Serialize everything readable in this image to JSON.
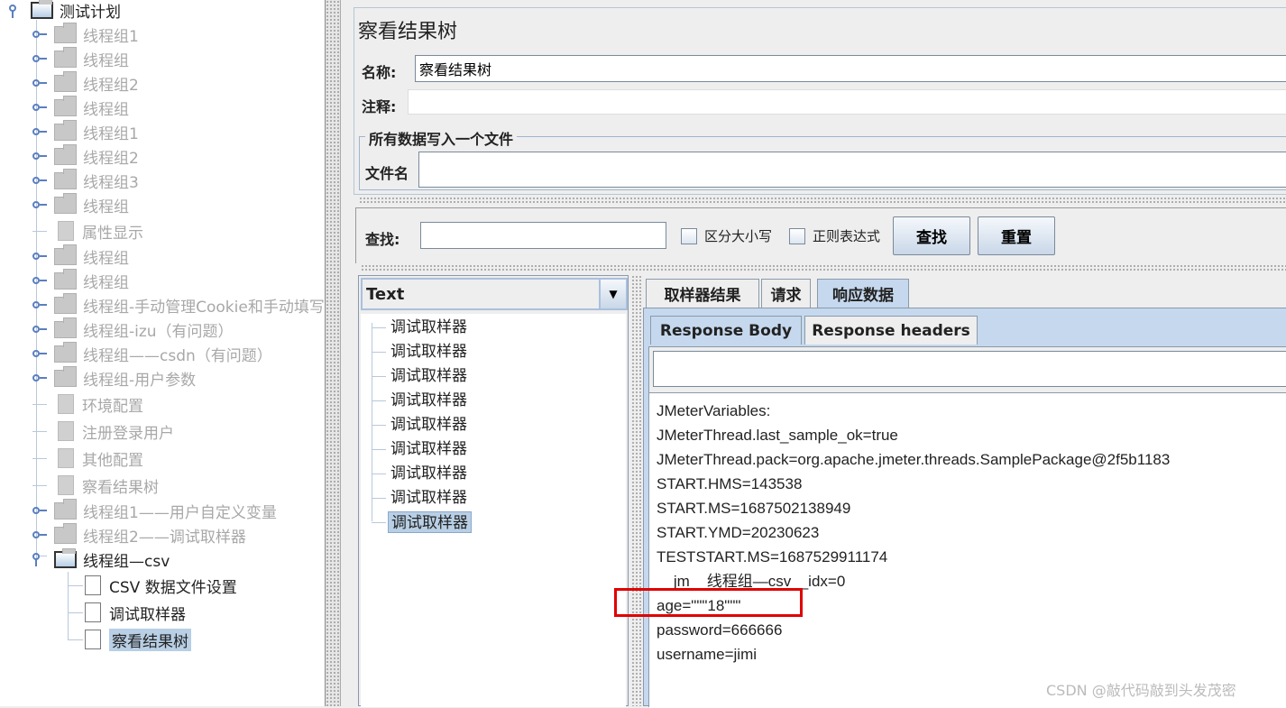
{
  "tree": {
    "root": "测试计划",
    "items": [
      {
        "label": "线程组1",
        "type": "folder",
        "enabled": false
      },
      {
        "label": "线程组",
        "type": "folder",
        "enabled": false
      },
      {
        "label": "线程组2",
        "type": "folder",
        "enabled": false
      },
      {
        "label": "线程组",
        "type": "folder",
        "enabled": false
      },
      {
        "label": "线程组1",
        "type": "folder",
        "enabled": false
      },
      {
        "label": "线程组2",
        "type": "folder",
        "enabled": false
      },
      {
        "label": "线程组3",
        "type": "folder",
        "enabled": false
      },
      {
        "label": "线程组",
        "type": "folder",
        "enabled": false
      },
      {
        "label": "属性显示",
        "type": "doc",
        "enabled": false
      },
      {
        "label": "线程组",
        "type": "folder",
        "enabled": false
      },
      {
        "label": "线程组",
        "type": "folder",
        "enabled": false
      },
      {
        "label": "线程组-手动管理Cookie和手动填写",
        "type": "folder",
        "enabled": false
      },
      {
        "label": "线程组-izu（有问题）",
        "type": "folder",
        "enabled": false
      },
      {
        "label": "线程组——csdn（有问题）",
        "type": "folder",
        "enabled": false
      },
      {
        "label": "线程组-用户参数",
        "type": "folder",
        "enabled": false
      },
      {
        "label": "环境配置",
        "type": "doc",
        "enabled": false
      },
      {
        "label": "注册登录用户",
        "type": "doc",
        "enabled": false
      },
      {
        "label": "其他配置",
        "type": "doc",
        "enabled": false
      },
      {
        "label": "察看结果树",
        "type": "doc",
        "enabled": false
      },
      {
        "label": "线程组1——用户自定义变量",
        "type": "folder",
        "enabled": false
      },
      {
        "label": "线程组2——调试取样器",
        "type": "folder",
        "enabled": false
      },
      {
        "label": "线程组—csv",
        "type": "folder",
        "enabled": true,
        "open": true
      }
    ],
    "children": [
      {
        "label": "CSV 数据文件设置",
        "selected": false
      },
      {
        "label": "调试取样器",
        "selected": false
      },
      {
        "label": "察看结果树",
        "selected": true
      }
    ]
  },
  "header": {
    "title": "察看结果树",
    "name_label": "名称:",
    "name_value": "察看结果树",
    "comment_label": "注释:",
    "file_group_title": "所有数据写入一个文件",
    "file_label": "文件名"
  },
  "search": {
    "label": "查找:",
    "value": "",
    "case_label": "区分大小写",
    "regex_label": "正则表达式",
    "find_button": "查找",
    "reset_button": "重置"
  },
  "renderer": {
    "selected": "Text"
  },
  "samples": [
    "调试取样器",
    "调试取样器",
    "调试取样器",
    "调试取样器",
    "调试取样器",
    "调试取样器",
    "调试取样器",
    "调试取样器",
    "调试取样器"
  ],
  "tabs": [
    "取样器结果",
    "请求",
    "响应数据"
  ],
  "active_tab": "响应数据",
  "subtabs": [
    "Response Body",
    "Response headers"
  ],
  "response_lines": [
    "JMeterVariables:",
    "JMeterThread.last_sample_ok=true",
    "JMeterThread.pack=org.apache.jmeter.threads.SamplePackage@2f5b1183",
    "START.HMS=143538",
    "START.MS=1687502138949",
    "START.YMD=20230623",
    "TESTSTART.MS=1687529911174",
    "__jm__线程组—csv__idx=0",
    "age=\"\"\"18\"\"\"",
    "password=666666",
    "username=jimi"
  ],
  "highlight_color": "#e00000",
  "watermark": "CSDN @敲代码敲到头发茂密"
}
